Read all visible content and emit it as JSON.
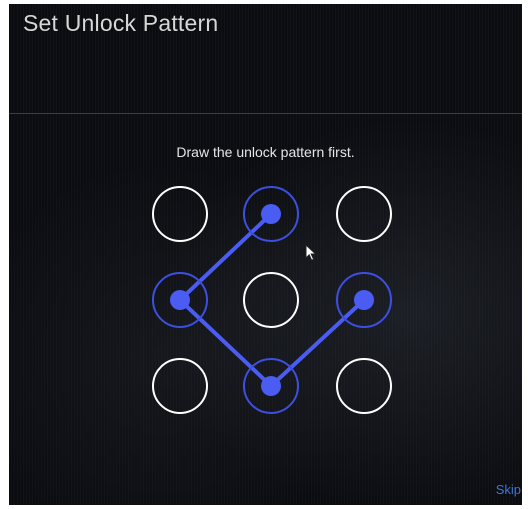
{
  "dialog": {
    "title": "Set Unlock Pattern",
    "instruction": "Draw the unlock pattern first.",
    "skip_label": "Skip"
  },
  "pattern": {
    "grid": [
      [
        "dot-1",
        "dot-2",
        "dot-3"
      ],
      [
        "dot-4",
        "dot-5",
        "dot-6"
      ],
      [
        "dot-7",
        "dot-8",
        "dot-9"
      ]
    ],
    "selected_sequence": [
      6,
      8,
      4,
      2
    ],
    "colors": {
      "idle_ring": "#ffffff",
      "active_ring": "#3d4fe0",
      "active_dot": "#4a5cf2",
      "line": "#4a5cf2"
    }
  }
}
